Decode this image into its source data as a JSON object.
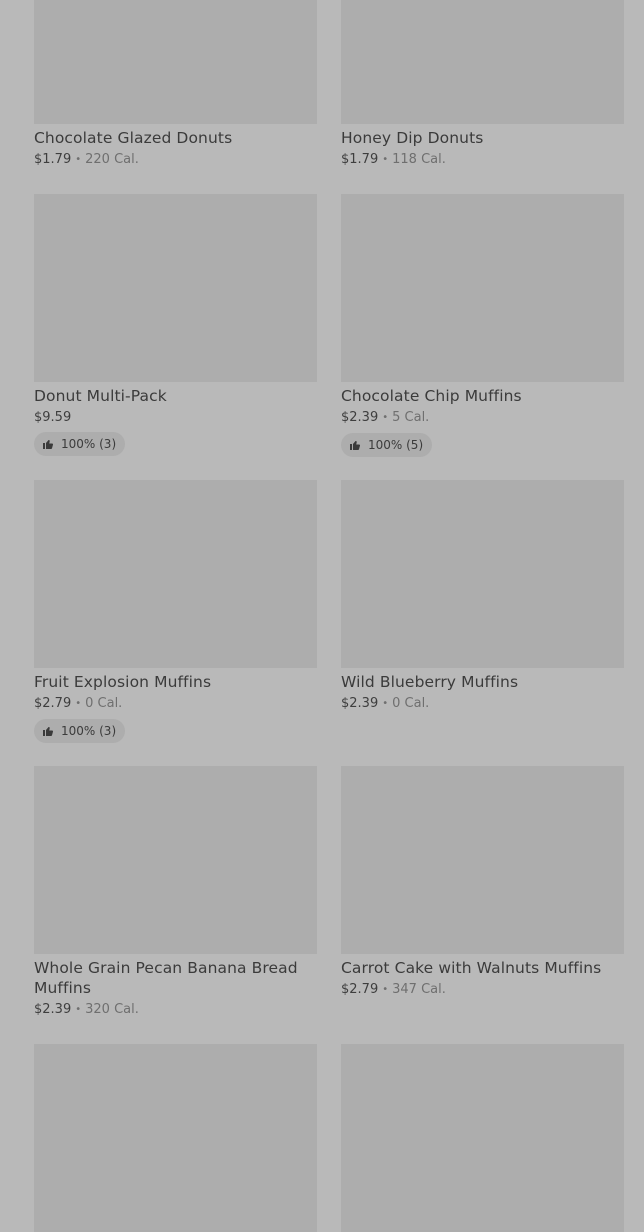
{
  "items": [
    {
      "name": "Chocolate Glazed Donuts",
      "price": "$1.79",
      "separator": "•",
      "calories": "220 Cal."
    },
    {
      "name": "Honey Dip Donuts",
      "price": "$1.79",
      "separator": "•",
      "calories": "118 Cal."
    },
    {
      "name": "Donut Multi-Pack",
      "price": "$9.59",
      "rating": "100% (3)"
    },
    {
      "name": "Chocolate Chip Muffins",
      "price": "$2.39",
      "separator": "•",
      "calories": "5 Cal.",
      "rating": "100% (5)"
    },
    {
      "name": "Fruit Explosion Muffins",
      "price": "$2.79",
      "separator": "•",
      "calories": "0 Cal.",
      "rating": "100% (3)"
    },
    {
      "name": "Wild Blueberry Muffins",
      "price": "$2.39",
      "separator": "•",
      "calories": "0 Cal."
    },
    {
      "name": "Whole Grain Pecan Banana Bread Muffins",
      "price": "$2.39",
      "separator": "•",
      "calories": "320 Cal."
    },
    {
      "name": "Carrot Cake with Walnuts Muffins",
      "price": "$2.79",
      "separator": "•",
      "calories": "347 Cal."
    }
  ],
  "icons": {
    "rating": "thumbs-up-icon"
  },
  "colors": {
    "background": "#b9b9b9",
    "image_placeholder": "#adadad",
    "text_primary": "#3b3b3b",
    "text_secondary": "#6f6f6f"
  }
}
